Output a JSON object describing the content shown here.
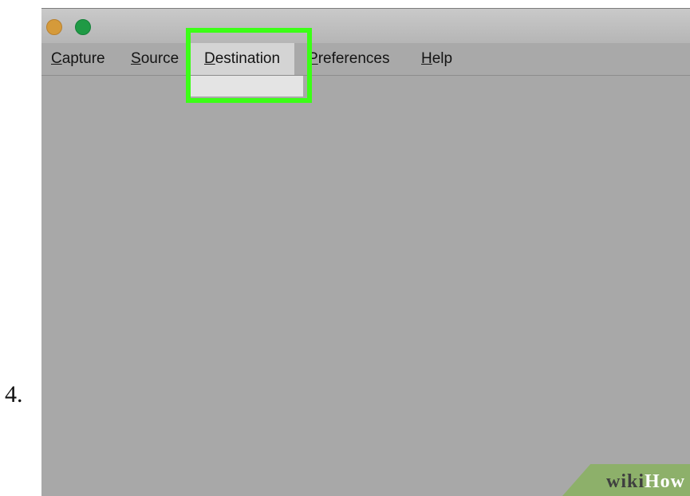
{
  "step": {
    "number": "4."
  },
  "window": {
    "title_buttons": [
      {
        "name": "minimize",
        "color": "#d59a3a"
      },
      {
        "name": "maximize",
        "color": "#1f9a45"
      }
    ]
  },
  "menubar": {
    "items": [
      {
        "id": "capture",
        "accel": "C",
        "rest": "apture"
      },
      {
        "id": "source",
        "accel": "S",
        "rest": "ource"
      },
      {
        "id": "destination",
        "accel": "D",
        "rest": "estination",
        "active": true
      },
      {
        "id": "preferences",
        "accel": "P",
        "rest": "references"
      },
      {
        "id": "help",
        "accel": "H",
        "rest": "elp"
      }
    ]
  },
  "highlight": {
    "color": "#3bff16",
    "target": "destination"
  },
  "watermark": {
    "part1": "wiki",
    "part2": "How",
    "background": "#8db06a"
  }
}
